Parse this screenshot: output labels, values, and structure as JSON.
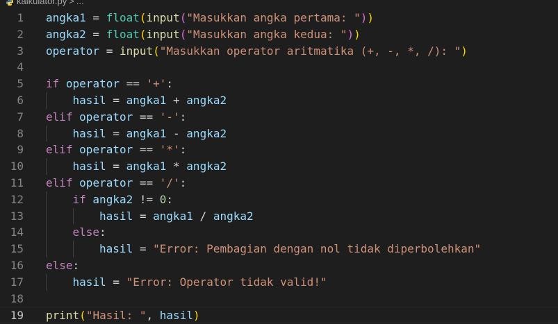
{
  "breadcrumb": {
    "file_name": "kalkulator.py",
    "separator": ">",
    "ellipsis": "..."
  },
  "editor": {
    "current_line": 19,
    "lines": [
      {
        "n": "1",
        "indent": 0,
        "tokens": [
          [
            "var",
            "angka1"
          ],
          [
            "op",
            " = "
          ],
          [
            "bi",
            "float"
          ],
          [
            "p1",
            "("
          ],
          [
            "fn",
            "input"
          ],
          [
            "p2",
            "("
          ],
          [
            "str",
            "\"Masukkan angka pertama: \""
          ],
          [
            "p2",
            ")"
          ],
          [
            "p1",
            ")"
          ]
        ]
      },
      {
        "n": "2",
        "indent": 0,
        "tokens": [
          [
            "var",
            "angka2"
          ],
          [
            "op",
            " = "
          ],
          [
            "bi",
            "float"
          ],
          [
            "p1",
            "("
          ],
          [
            "fn",
            "input"
          ],
          [
            "p2",
            "("
          ],
          [
            "str",
            "\"Masukkan angka kedua: \""
          ],
          [
            "p2",
            ")"
          ],
          [
            "p1",
            ")"
          ]
        ]
      },
      {
        "n": "3",
        "indent": 0,
        "tokens": [
          [
            "var",
            "operator"
          ],
          [
            "op",
            " = "
          ],
          [
            "fn",
            "input"
          ],
          [
            "p1",
            "("
          ],
          [
            "str",
            "\"Masukkan operator aritmatika (+, -, *, /): \""
          ],
          [
            "p1",
            ")"
          ]
        ]
      },
      {
        "n": "4",
        "indent": 0,
        "tokens": []
      },
      {
        "n": "5",
        "indent": 0,
        "tokens": [
          [
            "kw",
            "if"
          ],
          [
            "op",
            " "
          ],
          [
            "var",
            "operator"
          ],
          [
            "op",
            " == "
          ],
          [
            "str",
            "'+'"
          ],
          [
            "op",
            ":"
          ]
        ]
      },
      {
        "n": "6",
        "indent": 1,
        "tokens": [
          [
            "var",
            "hasil"
          ],
          [
            "op",
            " = "
          ],
          [
            "var",
            "angka1"
          ],
          [
            "op",
            " + "
          ],
          [
            "var",
            "angka2"
          ]
        ]
      },
      {
        "n": "7",
        "indent": 0,
        "tokens": [
          [
            "kw",
            "elif"
          ],
          [
            "op",
            " "
          ],
          [
            "var",
            "operator"
          ],
          [
            "op",
            " == "
          ],
          [
            "str",
            "'-'"
          ],
          [
            "op",
            ":"
          ]
        ]
      },
      {
        "n": "8",
        "indent": 1,
        "tokens": [
          [
            "var",
            "hasil"
          ],
          [
            "op",
            " = "
          ],
          [
            "var",
            "angka1"
          ],
          [
            "op",
            " - "
          ],
          [
            "var",
            "angka2"
          ]
        ]
      },
      {
        "n": "9",
        "indent": 0,
        "tokens": [
          [
            "kw",
            "elif"
          ],
          [
            "op",
            " "
          ],
          [
            "var",
            "operator"
          ],
          [
            "op",
            " == "
          ],
          [
            "str",
            "'*'"
          ],
          [
            "op",
            ":"
          ]
        ]
      },
      {
        "n": "10",
        "indent": 1,
        "tokens": [
          [
            "var",
            "hasil"
          ],
          [
            "op",
            " = "
          ],
          [
            "var",
            "angka1"
          ],
          [
            "op",
            " * "
          ],
          [
            "var",
            "angka2"
          ]
        ]
      },
      {
        "n": "11",
        "indent": 0,
        "tokens": [
          [
            "kw",
            "elif"
          ],
          [
            "op",
            " "
          ],
          [
            "var",
            "operator"
          ],
          [
            "op",
            " == "
          ],
          [
            "str",
            "'/'"
          ],
          [
            "op",
            ":"
          ]
        ]
      },
      {
        "n": "12",
        "indent": 1,
        "tokens": [
          [
            "kw",
            "if"
          ],
          [
            "op",
            " "
          ],
          [
            "var",
            "angka2"
          ],
          [
            "op",
            " != "
          ],
          [
            "num",
            "0"
          ],
          [
            "op",
            ":"
          ]
        ]
      },
      {
        "n": "13",
        "indent": 2,
        "tokens": [
          [
            "var",
            "hasil"
          ],
          [
            "op",
            " = "
          ],
          [
            "var",
            "angka1"
          ],
          [
            "op",
            " / "
          ],
          [
            "var",
            "angka2"
          ]
        ]
      },
      {
        "n": "14",
        "indent": 1,
        "tokens": [
          [
            "kw",
            "else"
          ],
          [
            "op",
            ":"
          ]
        ]
      },
      {
        "n": "15",
        "indent": 2,
        "tokens": [
          [
            "var",
            "hasil"
          ],
          [
            "op",
            " = "
          ],
          [
            "str",
            "\"Error: Pembagian dengan nol tidak diperbolehkan\""
          ]
        ]
      },
      {
        "n": "16",
        "indent": 0,
        "tokens": [
          [
            "kw",
            "else"
          ],
          [
            "op",
            ":"
          ]
        ]
      },
      {
        "n": "17",
        "indent": 1,
        "tokens": [
          [
            "var",
            "hasil"
          ],
          [
            "op",
            " = "
          ],
          [
            "str",
            "\"Error: Operator tidak valid!\""
          ]
        ]
      },
      {
        "n": "18",
        "indent": 0,
        "tokens": []
      },
      {
        "n": "19",
        "indent": 0,
        "tokens": [
          [
            "fn",
            "print"
          ],
          [
            "p1",
            "("
          ],
          [
            "str",
            "\"Hasil: \""
          ],
          [
            "op",
            ", "
          ],
          [
            "var",
            "hasil"
          ],
          [
            "p1",
            ")"
          ]
        ]
      }
    ]
  }
}
